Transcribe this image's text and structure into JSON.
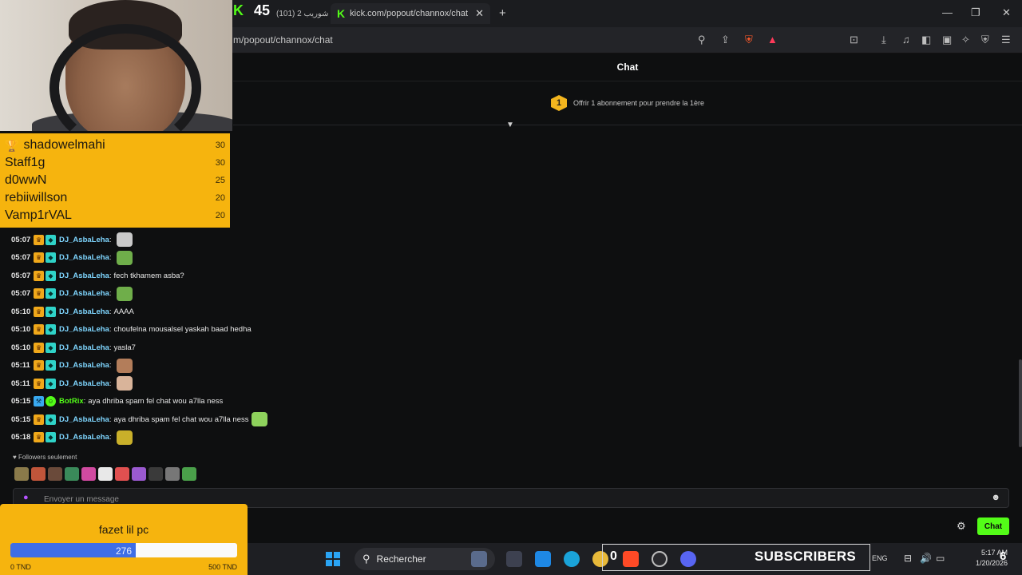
{
  "browser": {
    "inactive_tab": "شوريب 2 (101)",
    "active_tab_title": "kick.com/popout/channox/chat",
    "url": "m/popout/channox/chat",
    "stream_counter": "45"
  },
  "chat": {
    "header_title": "Chat",
    "gift_badge": "1",
    "gift_text": "Offrir 1 abonnement pour prendre la 1ère",
    "messages": [
      {
        "time": "05:07",
        "user": "DJ_AsbaLeha",
        "text": ""
      },
      {
        "time": "05:07",
        "user": "DJ_AsbaLeha",
        "text": ""
      },
      {
        "time": "05:07",
        "user": "DJ_AsbaLeha",
        "text": "fech tkhamem asba?"
      },
      {
        "time": "05:07",
        "user": "DJ_AsbaLeha",
        "text": ""
      },
      {
        "time": "05:10",
        "user": "DJ_AsbaLeha",
        "text": "AAAA"
      },
      {
        "time": "05:10",
        "user": "DJ_AsbaLeha",
        "text": "choufelna mousalsel yaskah baad hedha"
      },
      {
        "time": "05:10",
        "user": "DJ_AsbaLeha",
        "text": "yasla7"
      },
      {
        "time": "05:11",
        "user": "DJ_AsbaLeha",
        "text": ""
      },
      {
        "time": "05:11",
        "user": "DJ_AsbaLeha",
        "text": ""
      },
      {
        "time": "05:15",
        "user": "BotRix",
        "text": "aya dhriba spam fel chat wou a7lla ness"
      },
      {
        "time": "05:15",
        "user": "DJ_AsbaLeha",
        "text": "aya dhriba spam fel chat wou a7lla ness"
      },
      {
        "time": "05:18",
        "user": "DJ_AsbaLeha",
        "text": ""
      }
    ],
    "followers_label": "♥ Followers seulement",
    "composer_placeholder": "Envoyer un message",
    "chat_button": "Chat"
  },
  "leaderboard": [
    {
      "name": "shadowelmahi",
      "score": "30"
    },
    {
      "name": "Staff1g",
      "score": "30"
    },
    {
      "name": "d0wwN",
      "score": "25"
    },
    {
      "name": "rebiiwillson",
      "score": "20"
    },
    {
      "name": "Vamp1rVAL",
      "score": "20"
    }
  ],
  "goal": {
    "title": "fazet lil pc",
    "current": "276",
    "min_label": "0 TND",
    "max_label": "500 TND",
    "progress_fraction": 0.552,
    "bar_color": "#3f6ee6"
  },
  "taskbar": {
    "search_label": "Rechercher",
    "tray_count": "0",
    "subscribers_label": "SUBSCRIBERS",
    "lang": "ENG",
    "time": "5:17 AM",
    "date": "1/20/2026",
    "notif_count": "6"
  },
  "colors": {
    "kick_green": "#53fc18",
    "overlay_gold": "#f6b40e",
    "username_blue": "#7fd6ff"
  }
}
